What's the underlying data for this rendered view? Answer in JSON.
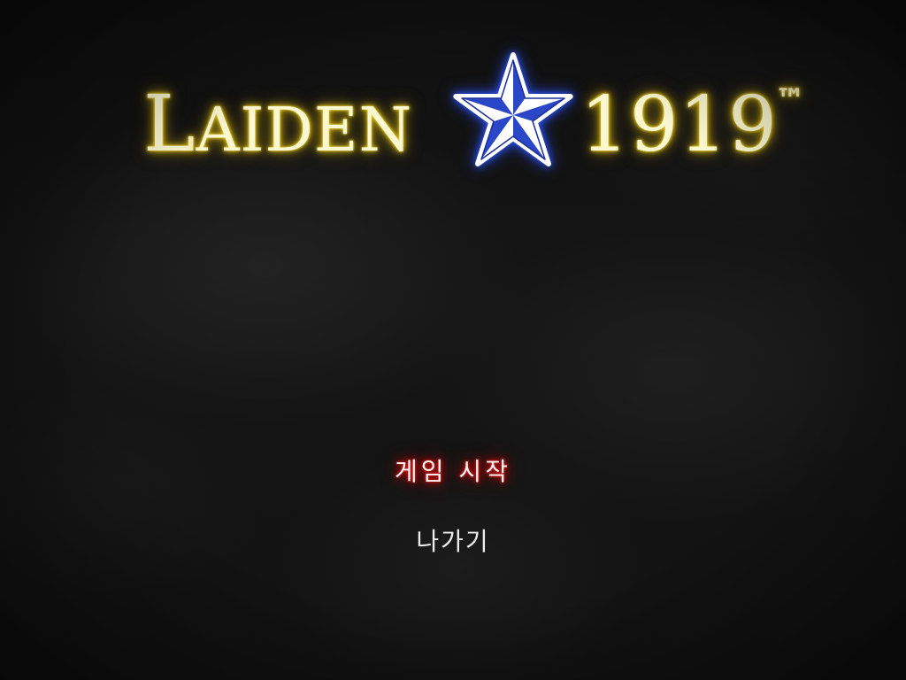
{
  "logo": {
    "title_first": "L",
    "title_rest": "AIDEN",
    "year": "1919",
    "trademark": "™",
    "star_icon": "nautical-star-icon",
    "text_glow_color": "#e8cc1c",
    "star_color": "#2a47c8"
  },
  "menu": {
    "items": [
      {
        "label": "게임 시작",
        "selected": true,
        "highlight_color": "#e00000"
      },
      {
        "label": "나가기",
        "selected": false
      }
    ]
  }
}
